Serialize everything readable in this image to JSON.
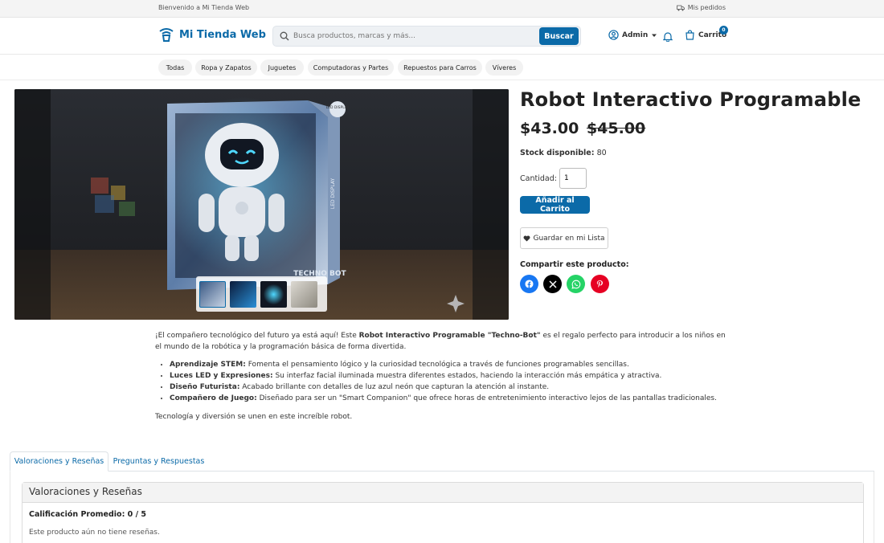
{
  "topbar": {
    "welcome": "Bienvenido a Mi Tienda Web",
    "orders": "Mis pedidos"
  },
  "header": {
    "brand": "Mi Tienda Web",
    "search_placeholder": "Busca productos, marcas y más...",
    "search_button": "Buscar",
    "user": "Admin",
    "cart_label": "Carrito",
    "cart_count": "0"
  },
  "categories": [
    "Todas",
    "Ropa y Zapatos",
    "Juguetes",
    "Computadoras y Partes",
    "Repuestos para Carros",
    "Víveres"
  ],
  "product": {
    "title": "Robot Interactivo Programable",
    "price": "$43.00",
    "old_price": "$45.00",
    "stock_label": "Stock disponible:",
    "stock_value": "80",
    "qty_label": "Cantidad:",
    "qty_value": "1",
    "add_to_cart": "Añadir al Carrito",
    "wishlist": "Guardar en mi Lista",
    "share_label": "Compartir este producto:",
    "share": [
      "facebook",
      "x",
      "whatsapp",
      "pinterest"
    ]
  },
  "description": {
    "intro_pre": "¡El compañero tecnológico del futuro ya está aquí! Este ",
    "intro_bold": "Robot Interactivo Programable \"Techno-Bot\"",
    "intro_post": " es el regalo perfecto para introducir a los niños en el mundo de la robótica y la programación básica de forma divertida.",
    "features": [
      {
        "title": "Aprendizaje STEM:",
        "text": " Fomenta el pensamiento lógico y la curiosidad tecnológica a través de funciones programables sencillas."
      },
      {
        "title": "Luces LED y Expresiones:",
        "text": " Su interfaz facial iluminada muestra diferentes estados, haciendo la interacción más empática y atractiva."
      },
      {
        "title": "Diseño Futurista:",
        "text": " Acabado brillante con detalles de luz azul neón que capturan la atención al instante."
      },
      {
        "title": "Compañero de Juego:",
        "text": " Diseñado para ser un \"Smart Companion\" que ofrece horas de entretenimiento interactivo lejos de las pantallas tradicionales."
      }
    ],
    "closing": "Tecnología y diversión se unen en este increíble robot."
  },
  "image_text": {
    "box_side": "LED DISPLAY",
    "box_front": "TECHNO BOT"
  },
  "tabs": [
    "Valoraciones y Reseñas",
    "Preguntas y Respuestas"
  ],
  "reviews": {
    "heading": "Valoraciones y Reseñas",
    "average": "Calificación Promedio: 0 / 5",
    "empty": "Este producto aún no tiene reseñas."
  },
  "colors": {
    "primary": "#0b6aa8",
    "facebook": "#1877f2",
    "x": "#000000",
    "whatsapp": "#25d366",
    "pinterest": "#e60023"
  }
}
